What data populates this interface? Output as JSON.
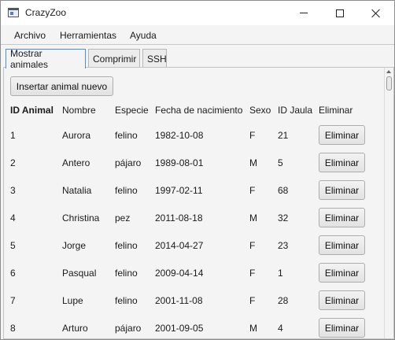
{
  "window": {
    "title": "CrazyZoo"
  },
  "menu": {
    "items": [
      "Archivo",
      "Herramientas",
      "Ayuda"
    ]
  },
  "tabs": [
    "Mostrar animales",
    "Comprimir",
    "SSH"
  ],
  "toolbar": {
    "insert_label": "Insertar animal nuevo"
  },
  "table": {
    "headers": [
      "ID Animal",
      "Nombre",
      "Especie",
      "Fecha de nacimiento",
      "Sexo",
      "ID Jaula",
      "Eliminar"
    ],
    "delete_label": "Eliminar",
    "rows": [
      [
        "1",
        "Aurora",
        "felino",
        "1982-10-08",
        "F",
        "21"
      ],
      [
        "2",
        "Antero",
        "pájaro",
        "1989-08-01",
        "M",
        "5"
      ],
      [
        "3",
        "Natalia",
        "felino",
        "1997-02-11",
        "F",
        "68"
      ],
      [
        "4",
        "Christina",
        "pez",
        "2011-08-18",
        "M",
        "32"
      ],
      [
        "5",
        "Jorge",
        "felino",
        "2014-04-27",
        "F",
        "23"
      ],
      [
        "6",
        "Pasqual",
        "felino",
        "2009-04-14",
        "F",
        "1"
      ],
      [
        "7",
        "Lupe",
        "felino",
        "2001-11-08",
        "F",
        "28"
      ],
      [
        "8",
        "Arturo",
        "pájaro",
        "2001-09-05",
        "M",
        "4"
      ]
    ]
  },
  "colors": {
    "active_tab_border": "#4a90d9",
    "background": "#f4f4f4"
  }
}
